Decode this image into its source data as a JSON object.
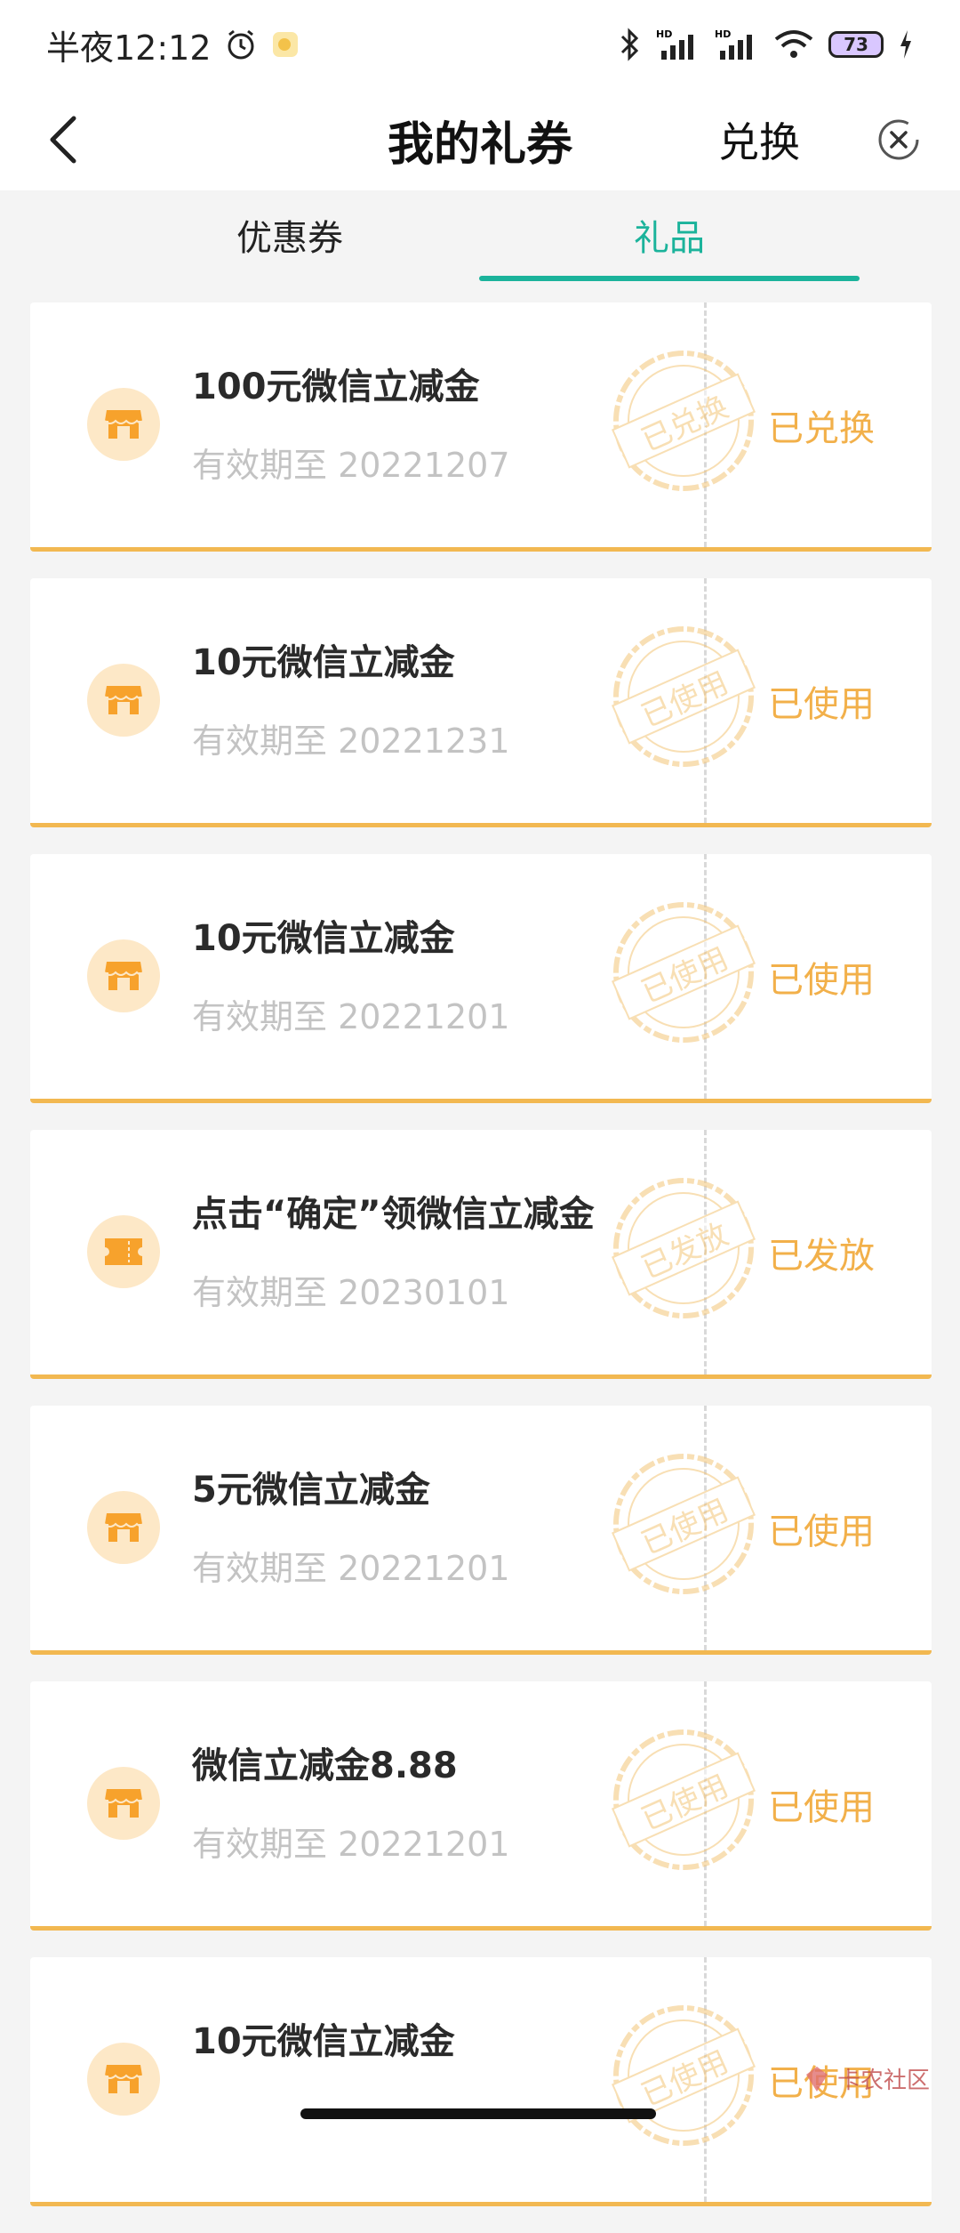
{
  "status_bar": {
    "time": "半夜12:12",
    "battery": "73"
  },
  "nav": {
    "title": "我的礼券",
    "action_label": "兑换"
  },
  "tabs": [
    {
      "label": "优惠券",
      "active": false
    },
    {
      "label": "礼品",
      "active": true
    }
  ],
  "cards": [
    {
      "title": "100元微信立减金",
      "date": "有效期至 20221207",
      "stamp": "已兑换",
      "status": "已兑换",
      "icon": "shop-icon"
    },
    {
      "title": "10元微信立减金",
      "date": "有效期至 20221231",
      "stamp": "已使用",
      "status": "已使用",
      "icon": "shop-icon"
    },
    {
      "title": "10元微信立减金",
      "date": "有效期至 20221201",
      "stamp": "已使用",
      "status": "已使用",
      "icon": "shop-icon"
    },
    {
      "title": "点击“确定”领微信立减金",
      "date": "有效期至 20230101",
      "stamp": "已发放",
      "status": "已发放",
      "icon": "ticket-icon"
    },
    {
      "title": "5元微信立减金",
      "date": "有效期至 20221201",
      "stamp": "已使用",
      "status": "已使用",
      "icon": "shop-icon"
    },
    {
      "title": "微信立减金8.88",
      "date": "有效期至 20221201",
      "stamp": "已使用",
      "status": "已使用",
      "icon": "shop-icon"
    },
    {
      "title": "10元微信立减金",
      "date": "",
      "stamp": "已使用",
      "status": "已使用",
      "icon": "shop-icon"
    }
  ],
  "watermark": "卡农社区",
  "colors": {
    "accent": "#1bb39b",
    "status": "#f2b04a",
    "card_border": "#f2b851"
  }
}
